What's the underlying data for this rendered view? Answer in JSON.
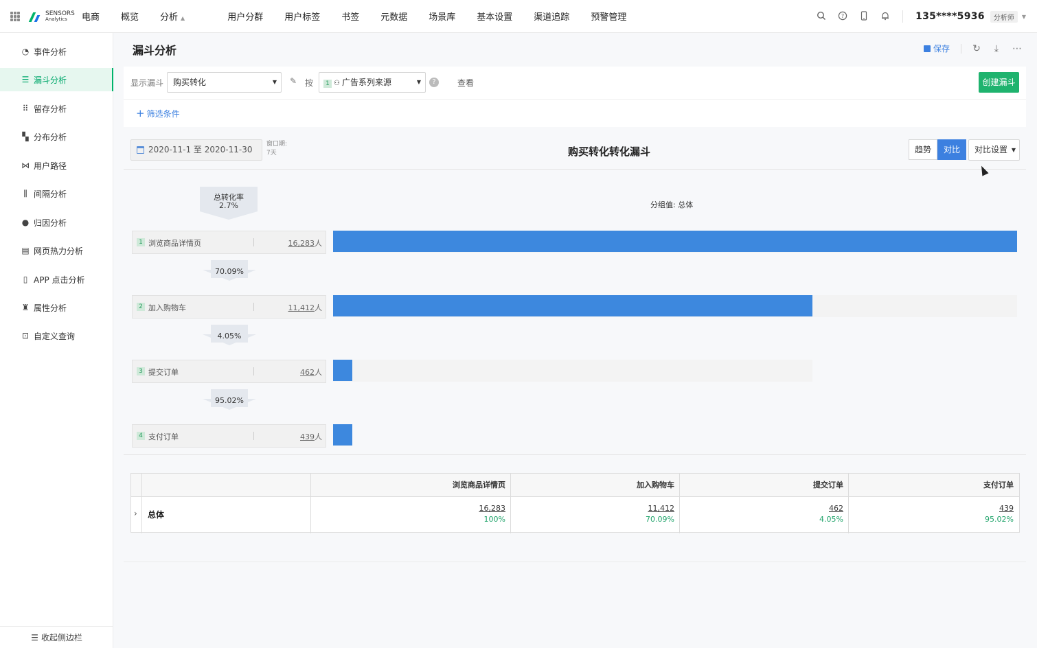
{
  "app": {
    "logo_line1": "SENSORS",
    "logo_line2": "Analytics",
    "nav": [
      "电商",
      "概览",
      "分析",
      "用户分群",
      "用户标签",
      "书签",
      "元数据",
      "场景库",
      "基本设置",
      "渠道追踪",
      "预警管理"
    ],
    "user": "135****5936",
    "role": "分析师"
  },
  "sidebar": {
    "items": [
      {
        "label": "事件分析",
        "icon": "event-icon"
      },
      {
        "label": "漏斗分析",
        "icon": "funnel-icon"
      },
      {
        "label": "留存分析",
        "icon": "retention-icon"
      },
      {
        "label": "分布分析",
        "icon": "distribution-icon"
      },
      {
        "label": "用户路径",
        "icon": "path-icon"
      },
      {
        "label": "间隔分析",
        "icon": "interval-icon"
      },
      {
        "label": "归因分析",
        "icon": "attribution-icon"
      },
      {
        "label": "网页热力分析",
        "icon": "heatmap-icon"
      },
      {
        "label": "APP 点击分析",
        "icon": "app-click-icon"
      },
      {
        "label": "属性分析",
        "icon": "attribute-icon"
      },
      {
        "label": "自定义查询",
        "icon": "custom-query-icon"
      }
    ],
    "active_index": 1,
    "collapse_label": "收起侧边栏"
  },
  "page": {
    "title": "漏斗分析",
    "save_label": "保存"
  },
  "config": {
    "show_funnel_label": "显示漏斗",
    "funnel_select": "购买转化",
    "by_label": "按",
    "group_badge": "1",
    "group_select": "广告系列来源",
    "view_label": "查看",
    "create_button": "创建漏斗",
    "filter_label": "筛选条件"
  },
  "chart": {
    "date_range": "2020-11-1 至 2020-11-30",
    "window_label": "窗口期:",
    "window_value": "7天",
    "title": "购买转化转化漏斗",
    "trend_tab": "趋势",
    "compare_tab": "对比",
    "compare_settings": "对比设置",
    "total_rate_label": "总转化率",
    "total_rate_value": "2.7%",
    "group_value_label": "分组值: 总体"
  },
  "chart_data": {
    "type": "bar",
    "title": "购买转化转化漏斗",
    "categories": [
      "浏览商品详情页",
      "加入购物车",
      "提交订单",
      "支付订单"
    ],
    "values": [
      16283,
      11412,
      462,
      439
    ],
    "value_labels": [
      "16,283",
      "11,412",
      "462",
      "439"
    ],
    "unit": "人",
    "conversion_rates": [
      "70.09%",
      "4.05%",
      "95.02%"
    ],
    "overall_rate": "2.7%",
    "orientation": "horizontal"
  },
  "table": {
    "headers": [
      "浏览商品详情页",
      "加入购物车",
      "提交订单",
      "支付订单"
    ],
    "row_label": "总体",
    "values": [
      "16,283",
      "11,412",
      "462",
      "439"
    ],
    "percents": [
      "100%",
      "70.09%",
      "4.05%",
      "95.02%"
    ]
  },
  "colors": {
    "accent": "#3c80e0",
    "brand_green": "#1fb36e",
    "bar": "#3d88de"
  }
}
